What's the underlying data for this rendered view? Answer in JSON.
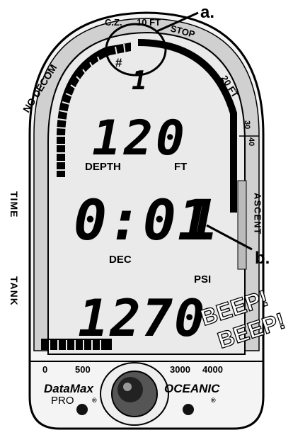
{
  "callouts": {
    "a": "a.",
    "b": "b."
  },
  "bezel": {
    "no_decom": "NO DECOM",
    "cz": "C.Z.",
    "ten_ft": "10 FT",
    "stop": "STOP",
    "twenty_ft": "20 FT",
    "thirty": "30",
    "forty": "40"
  },
  "side_labels": {
    "time": "TIME",
    "tank": "TANK",
    "ascent": "ASCENT"
  },
  "display": {
    "hash": "#",
    "stop_count": "1",
    "depth_value": "120",
    "depth_label": "DEPTH",
    "depth_unit": "FT",
    "time_value": "0:01",
    "time_extra": "1",
    "dec_label": "DEC",
    "psi_label": "PSI",
    "tank_value": "1270"
  },
  "beep": {
    "line1": "BEEP!",
    "line2": "BEEP!"
  },
  "pressure_scale": {
    "p0": "0",
    "p500": "500",
    "p3000": "3000",
    "p4000": "4000"
  },
  "brand": {
    "model": "DataMax",
    "reg1": "®",
    "sub": "PRO",
    "maker": "OCEANIC",
    "reg2": "®"
  }
}
